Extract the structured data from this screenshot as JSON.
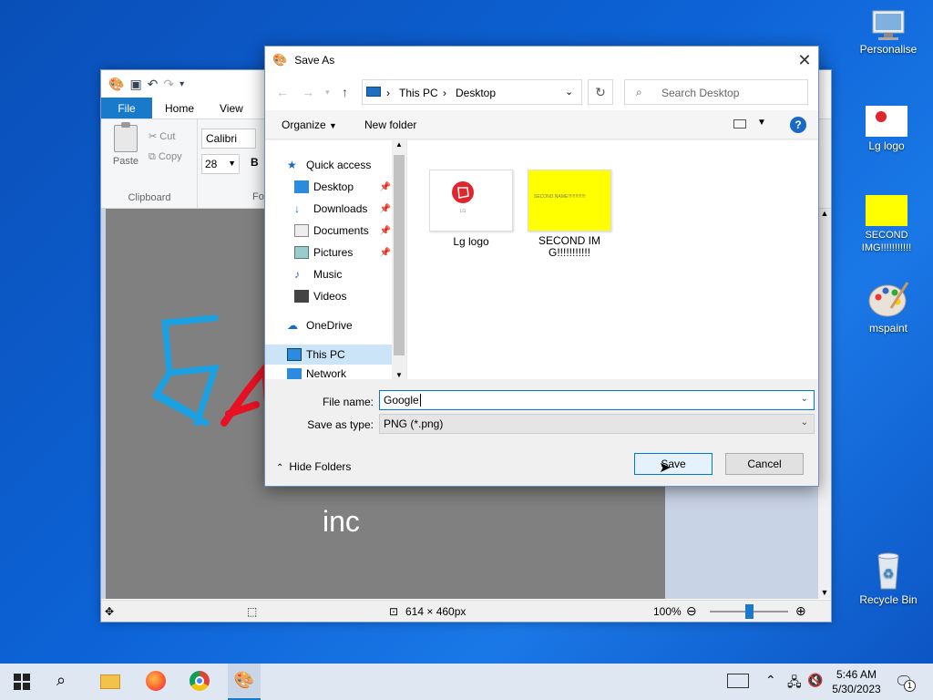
{
  "desktop": {
    "icons": [
      {
        "label": "Personalise"
      },
      {
        "label": "Lg logo"
      },
      {
        "label": "SECOND IMG!!!!!!!!!!!"
      },
      {
        "label": "mspaint"
      },
      {
        "label": "Recycle Bin"
      }
    ]
  },
  "paint": {
    "tabs": [
      "File",
      "Home",
      "View"
    ],
    "paste_label": "Paste",
    "cut_label": "Cut",
    "copy_label": "Copy",
    "clipboard_group": "Clipboard",
    "font_name": "Calibri",
    "font_size": "28",
    "bold_label": "B",
    "font_group_partial": "Fo",
    "canvas_text": "inc",
    "status": {
      "dimensions": "614 × 460px",
      "zoom": "100%"
    }
  },
  "dialog": {
    "title": "Save As",
    "breadcrumb": [
      "This PC",
      "Desktop"
    ],
    "search_placeholder": "Search Desktop",
    "organize_label": "Organize",
    "new_folder_label": "New folder",
    "nav_items": [
      {
        "label": "Quick access",
        "pinned": false
      },
      {
        "label": "Desktop",
        "pinned": true
      },
      {
        "label": "Downloads",
        "pinned": true
      },
      {
        "label": "Documents",
        "pinned": true
      },
      {
        "label": "Pictures",
        "pinned": true
      },
      {
        "label": "Music",
        "pinned": false
      },
      {
        "label": "Videos",
        "pinned": false
      },
      {
        "label": "OneDrive",
        "pinned": false
      },
      {
        "label": "This PC",
        "pinned": false
      },
      {
        "label": "Network",
        "pinned": false
      }
    ],
    "files": [
      {
        "name": "Lg logo"
      },
      {
        "name": "SECOND IMG!!!!!!!!!!!",
        "thumb_text": "SECOND NAME!!!!!!!!!!!!!!"
      }
    ],
    "file_name_label": "File name:",
    "file_name_value": "Google",
    "save_type_label": "Save as type:",
    "save_type_value": "PNG (*.png)",
    "hide_folders_label": "Hide Folders",
    "save_label": "Save",
    "cancel_label": "Cancel"
  },
  "taskbar": {
    "time": "5:46 AM",
    "date": "5/30/2023",
    "notification_count": "1"
  },
  "colors": {
    "accent": "#0078d7",
    "paint_file_tab": "#1979ca",
    "second_img_bg": "#ffff00",
    "lg_red": "#e0252d"
  }
}
